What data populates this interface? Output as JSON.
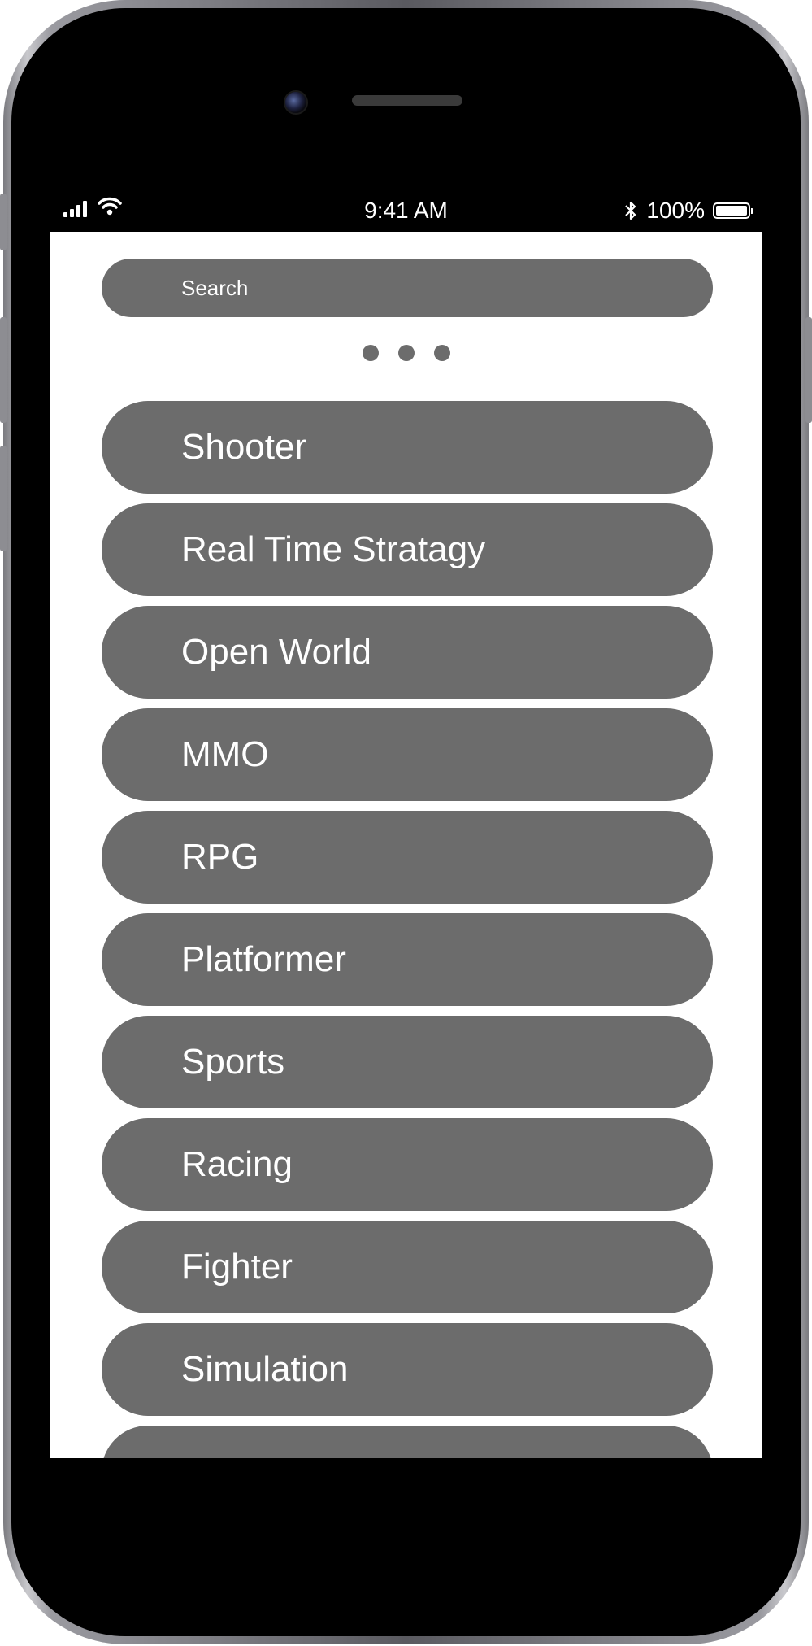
{
  "status_bar": {
    "time": "9:41 AM",
    "battery": "100%",
    "battery_level": 1.0,
    "signal_icon": "signal-icon",
    "wifi_icon": "wifi-icon",
    "bluetooth_icon": "bluetooth-icon"
  },
  "search": {
    "placeholder": "Search"
  },
  "page_indicator": {
    "icon": "more-dots-icon"
  },
  "genres": [
    {
      "label": "Shooter"
    },
    {
      "label": "Real Time Stratagy"
    },
    {
      "label": "Open World"
    },
    {
      "label": "MMO"
    },
    {
      "label": "RPG"
    },
    {
      "label": "Platformer"
    },
    {
      "label": "Sports"
    },
    {
      "label": "Racing"
    },
    {
      "label": "Fighter"
    },
    {
      "label": "Simulation"
    },
    {
      "label": ""
    }
  ],
  "colors": {
    "button_fill": "#6c6c6c",
    "button_text": "#ffffff",
    "screen_bg": "#ffffff",
    "phone_bezel": "#000000"
  }
}
